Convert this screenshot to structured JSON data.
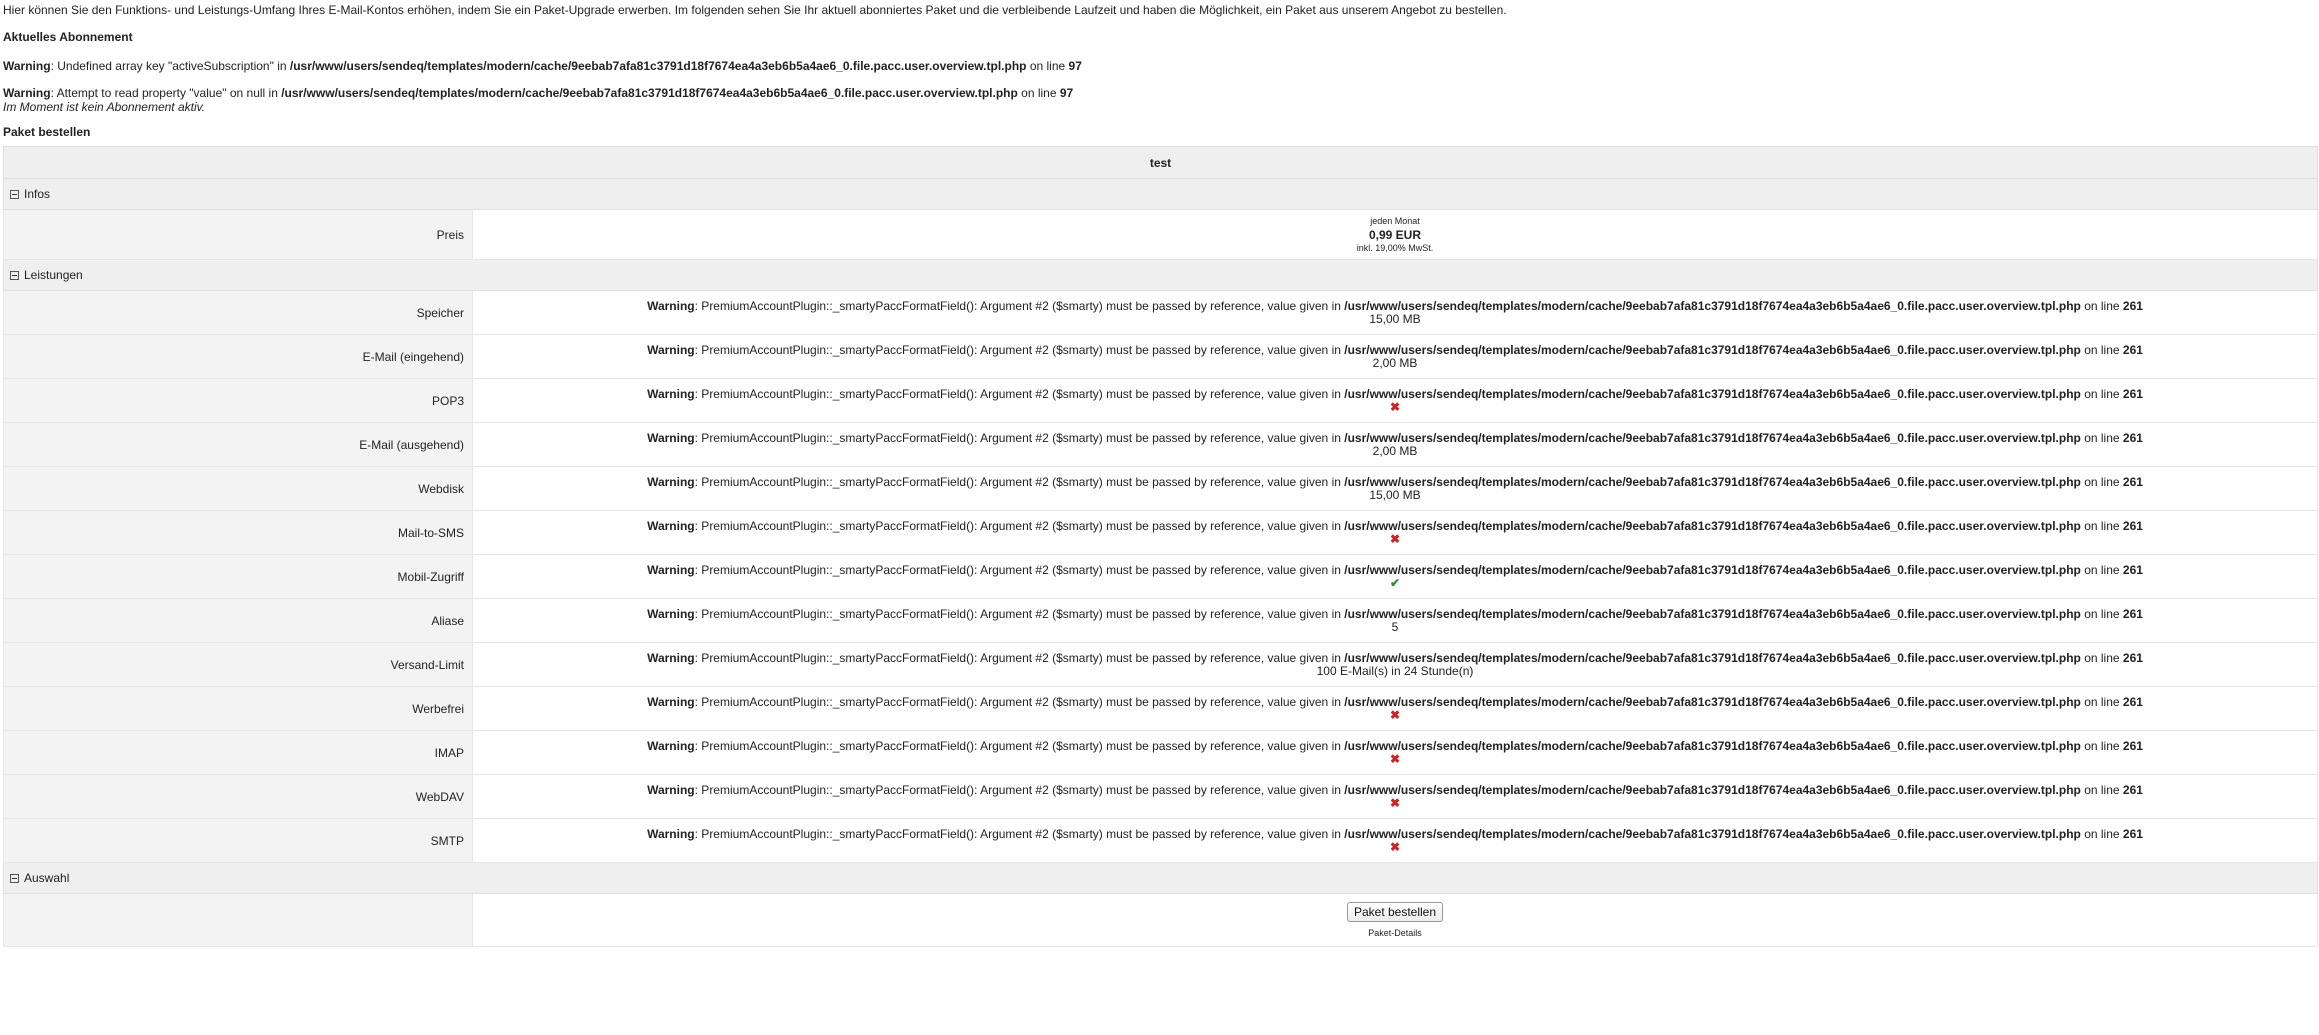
{
  "intro": "Hier können Sie den Funktions- und Leistungs-Umfang Ihres E-Mail-Kontos erhöhen, indem Sie ein Paket-Upgrade erwerben. Im folgenden sehen Sie Ihr aktuell abonniertes Paket und die verbleibende Laufzeit und haben die Möglichkeit, ein Paket aus unserem Angebot zu bestellen.",
  "current_heading": "Aktuelles Abonnement",
  "warnings": [
    {
      "label": "Warning",
      "text_pre": ": Undefined array key \"activeSubscription\" in ",
      "path": "/usr/www/users/sendeq/templates/modern/cache/9eebab7afa81c3791d18f7674ea4a3eb6b5a4ae6_0.file.pacc.user.overview.tpl.php",
      "text_mid": " on line ",
      "line": "97"
    },
    {
      "label": "Warning",
      "text_pre": ": Attempt to read property \"value\" on null in ",
      "path": "/usr/www/users/sendeq/templates/modern/cache/9eebab7afa81c3791d18f7674ea4a3eb6b5a4ae6_0.file.pacc.user.overview.tpl.php",
      "text_mid": " on line ",
      "line": "97"
    }
  ],
  "no_subscription": "Im Moment ist kein Abonnement aktiv.",
  "order_heading": "Paket bestellen",
  "package_name": "test",
  "sections": {
    "infos": "Infos",
    "leistungen": "Leistungen",
    "auswahl": "Auswahl"
  },
  "price": {
    "label": "Preis",
    "period": "jeden Monat",
    "amount": "0,99 EUR",
    "tax": "inkl. 19,00% MwSt."
  },
  "feature_warning": {
    "label": "Warning",
    "text_pre": ": PremiumAccountPlugin::_smartyPaccFormatField(): Argument #2 ($smarty) must be passed by reference, value given in ",
    "path": "/usr/www/users/sendeq/templates/modern/cache/9eebab7afa81c3791d18f7674ea4a3eb6b5a4ae6_0.file.pacc.user.overview.tpl.php",
    "text_mid": " on line ",
    "line": "261"
  },
  "features": [
    {
      "label": "Speicher",
      "value": "15,00 MB",
      "kind": "text"
    },
    {
      "label": "E-Mail (eingehend)",
      "value": "2,00 MB",
      "kind": "text"
    },
    {
      "label": "POP3",
      "value": "✖",
      "kind": "cross"
    },
    {
      "label": "E-Mail (ausgehend)",
      "value": "2,00 MB",
      "kind": "text"
    },
    {
      "label": "Webdisk",
      "value": "15,00 MB",
      "kind": "text"
    },
    {
      "label": "Mail-to-SMS",
      "value": "✖",
      "kind": "cross"
    },
    {
      "label": "Mobil-Zugriff",
      "value": "✔",
      "kind": "check"
    },
    {
      "label": "Aliase",
      "value": "5",
      "kind": "text"
    },
    {
      "label": "Versand-Limit",
      "value": "100 E-Mail(s) in 24 Stunde(n)",
      "kind": "text"
    },
    {
      "label": "Werbefrei",
      "value": "✖",
      "kind": "cross"
    },
    {
      "label": "IMAP",
      "value": "✖",
      "kind": "cross"
    },
    {
      "label": "WebDAV",
      "value": "✖",
      "kind": "cross"
    },
    {
      "label": "SMTP",
      "value": "✖",
      "kind": "cross"
    }
  ],
  "choice": {
    "button": "Paket bestellen",
    "details": "Paket-Details"
  },
  "colors": {
    "cross": "#d42020",
    "check": "#2e8b2e",
    "row_bg": "#efefef"
  }
}
